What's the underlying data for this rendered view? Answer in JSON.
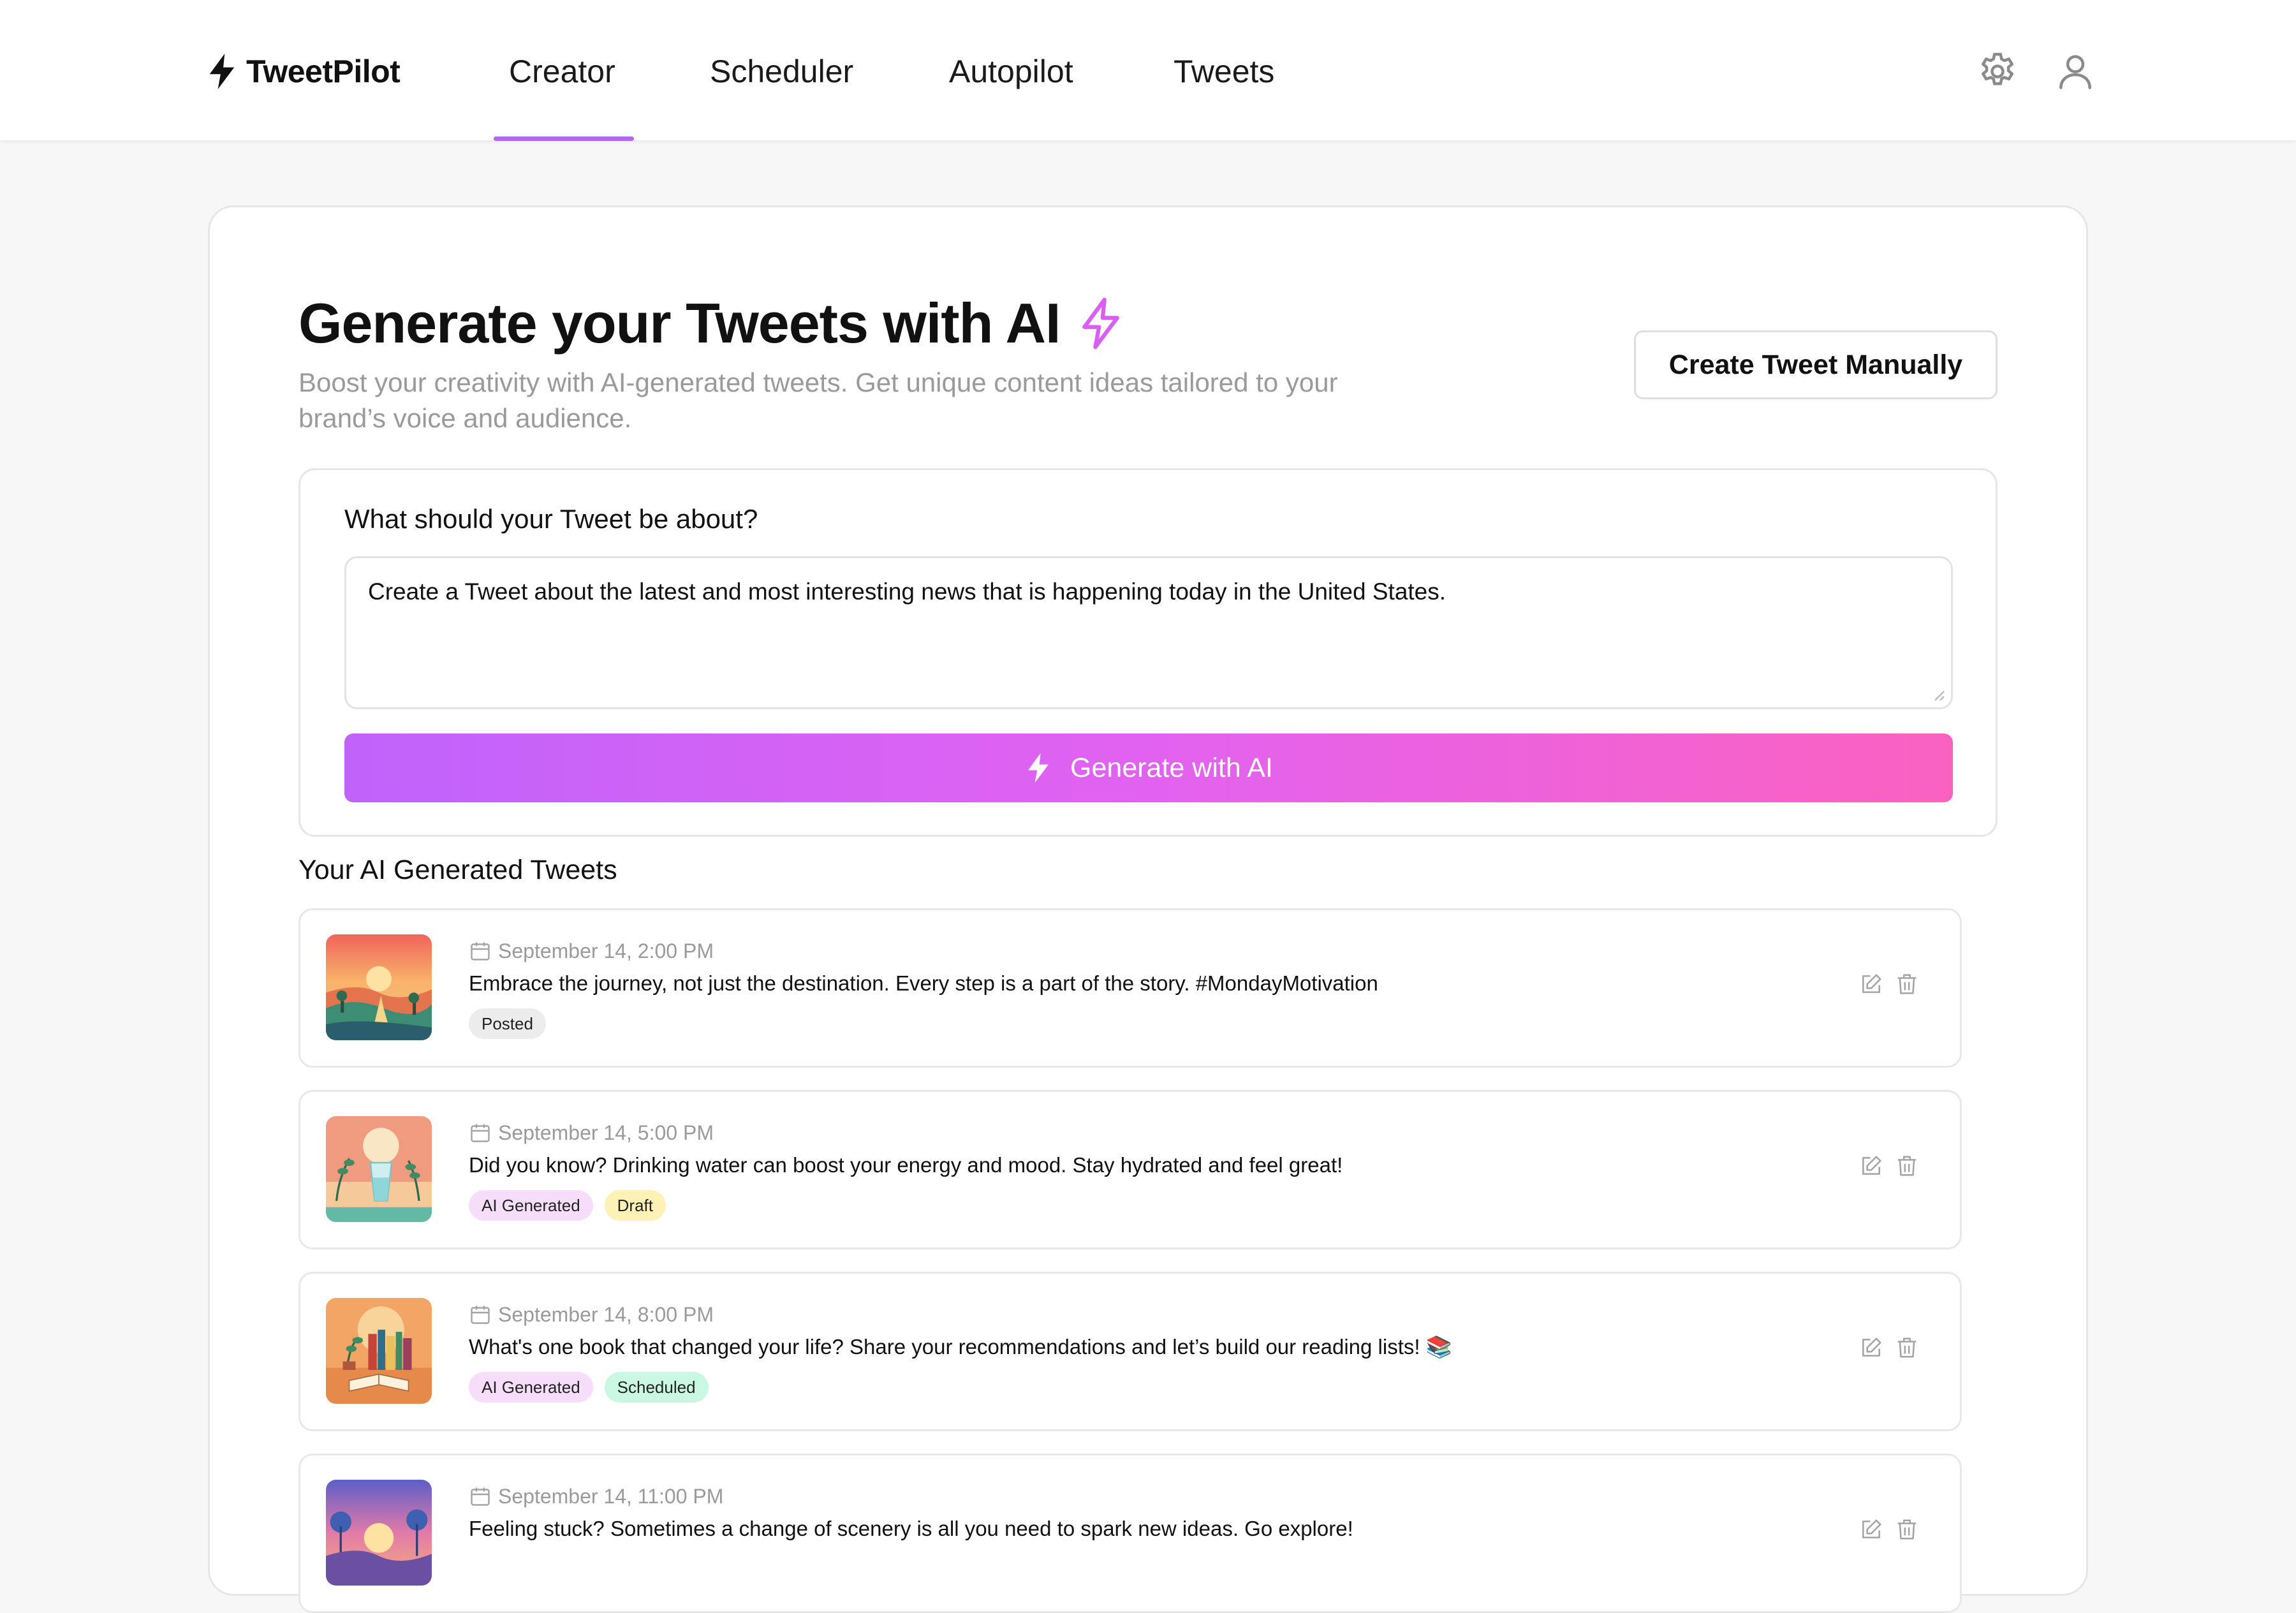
{
  "app": {
    "name": "TweetPilot",
    "logo_icon": "lightning-bolt-icon"
  },
  "nav": {
    "tabs": [
      {
        "label": "Creator",
        "active": true
      },
      {
        "label": "Scheduler",
        "active": false
      },
      {
        "label": "Autopilot",
        "active": false
      },
      {
        "label": "Tweets",
        "active": false
      }
    ],
    "active_color": "#b266f6"
  },
  "header_icons": [
    "gear-icon",
    "user-icon"
  ],
  "page": {
    "title": "Generate your Tweets with AI",
    "title_icon": "lightning-bolt-icon",
    "title_icon_color": "#d95ff0",
    "subtitle": "Boost your creativity with AI-generated tweets. Get unique content ideas tailored to your brand’s voice and audience.",
    "manual_button": "Create Tweet Manually"
  },
  "prompt": {
    "label": "What should your Tweet be about?",
    "value": "Create a Tweet about the latest and most interesting news that is happening today in the United States.",
    "generate_button": "Generate with AI",
    "gradient": [
      "#c063fb",
      "#fb62c0"
    ]
  },
  "generated": {
    "title": "Your AI Generated Tweets",
    "tweets": [
      {
        "date": "September 14, 2:00 PM",
        "text": "Embrace the journey, not just the destination. Every step is a part of the story. #MondayMotivation",
        "badges": [
          {
            "label": "Posted",
            "type": "posted"
          }
        ],
        "thumb": "sunset-path-illustration"
      },
      {
        "date": "September 14, 5:00 PM",
        "text": "Did you know? Drinking water can boost your energy and mood. Stay hydrated and feel great!",
        "badges": [
          {
            "label": "AI Generated",
            "type": "ai"
          },
          {
            "label": "Draft",
            "type": "draft"
          }
        ],
        "thumb": "water-glass-illustration"
      },
      {
        "date": "September 14, 8:00 PM",
        "text": "What's one book that changed your life? Share your recommendations and let’s build our reading lists! 📚",
        "badges": [
          {
            "label": "AI Generated",
            "type": "ai"
          },
          {
            "label": "Scheduled",
            "type": "scheduled"
          }
        ],
        "thumb": "books-illustration"
      },
      {
        "date": "September 14, 11:00 PM",
        "text": "Feeling stuck? Sometimes a change of scenery is all you need to spark new ideas. Go explore!",
        "badges": [],
        "thumb": "landscape-illustration"
      }
    ]
  },
  "colors": {
    "badge_posted": "#ececec",
    "badge_ai": "#f6ddfa",
    "badge_draft": "#fdf1b6",
    "badge_scheduled": "#c9f7e2"
  }
}
